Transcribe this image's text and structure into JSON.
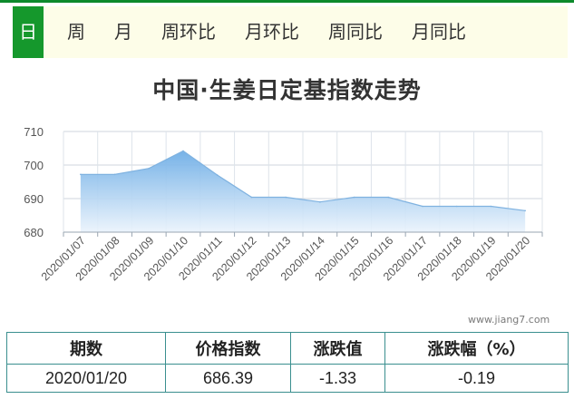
{
  "tabs": [
    "日",
    "周",
    "月",
    "周环比",
    "月环比",
    "周同比",
    "月同比"
  ],
  "active_tab": "日",
  "colors": {
    "accent": "#15982c",
    "area": "#7fb6e6",
    "line": "#6ea8dd",
    "table_border": "#3a8f8f"
  },
  "watermark": "www.jiang7.com",
  "chart_data": {
    "type": "area",
    "title": "中国·生姜日定基指数走势",
    "x": [
      "2020/01/07",
      "2020/01/08",
      "2020/01/09",
      "2020/01/10",
      "2020/01/11",
      "2020/01/12",
      "2020/01/13",
      "2020/01/14",
      "2020/01/15",
      "2020/01/16",
      "2020/01/17",
      "2020/01/18",
      "2020/01/19",
      "2020/01/20"
    ],
    "values": [
      697.2,
      697.2,
      699.0,
      704.2,
      697.0,
      690.4,
      690.4,
      689.0,
      690.4,
      690.4,
      687.7,
      687.7,
      687.7,
      686.4
    ],
    "ylim": [
      680,
      710
    ],
    "yticks": [
      680,
      690,
      700,
      710
    ],
    "grid": true
  },
  "table": {
    "headers": [
      "期数",
      "价格指数",
      "涨跌值",
      "涨跌幅（%）"
    ],
    "row": [
      "2020/01/20",
      "686.39",
      "-1.33",
      "-0.19"
    ]
  }
}
